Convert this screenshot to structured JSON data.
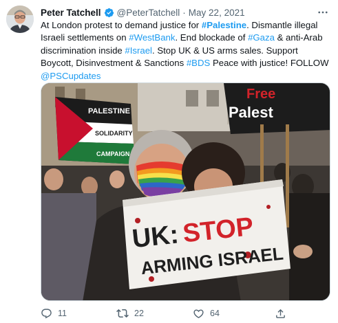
{
  "author": {
    "name": "Peter Tatchell",
    "handle": "@PeterTatchell",
    "date": "May 22, 2021",
    "separator": "·"
  },
  "tweet": {
    "segments": [
      {
        "text": "At London protest to demand justice for ",
        "style": "plain"
      },
      {
        "text": "#Palestine",
        "style": "hashtag-bold"
      },
      {
        "text": ". Dismantle illegal Israeli settlements on ",
        "style": "plain"
      },
      {
        "text": "#WestBank",
        "style": "hashtag"
      },
      {
        "text": ". End blockade of ",
        "style": "plain"
      },
      {
        "text": "#Gaza",
        "style": "hashtag"
      },
      {
        "text": " & anti-Arab discrimination inside ",
        "style": "plain"
      },
      {
        "text": "#Israel",
        "style": "hashtag"
      },
      {
        "text": ". Stop UK & US arms sales. Support Boycott, Disinvestment & Sanctions ",
        "style": "plain"
      },
      {
        "text": "#BDS",
        "style": "hashtag"
      },
      {
        "text": " Peace with justice! FOLLOW ",
        "style": "plain"
      },
      {
        "text": "@PSCupdates",
        "style": "hashtag"
      }
    ]
  },
  "photo": {
    "sign_line1_a": "UK:",
    "sign_line1_b": "STOP",
    "sign_line2": "ARMING ISRAEL",
    "flag_text1": "PALESTINE",
    "flag_text2": "SOLIDARITY",
    "flag_text3": "CAMPAIGN",
    "banner_text1": "Free",
    "banner_text2": "Palest"
  },
  "actions": {
    "replies": "11",
    "retweets": "22",
    "likes": "64"
  },
  "colors": {
    "link": "#1d9bf0",
    "verified": "#1d9bf0",
    "muted": "#536471",
    "sign_red": "#d2232a"
  },
  "icons": {
    "verified": "verified-badge-icon",
    "more": "more-dots-icon",
    "reply": "reply-icon",
    "retweet": "retweet-icon",
    "like": "heart-icon",
    "share": "share-icon"
  }
}
